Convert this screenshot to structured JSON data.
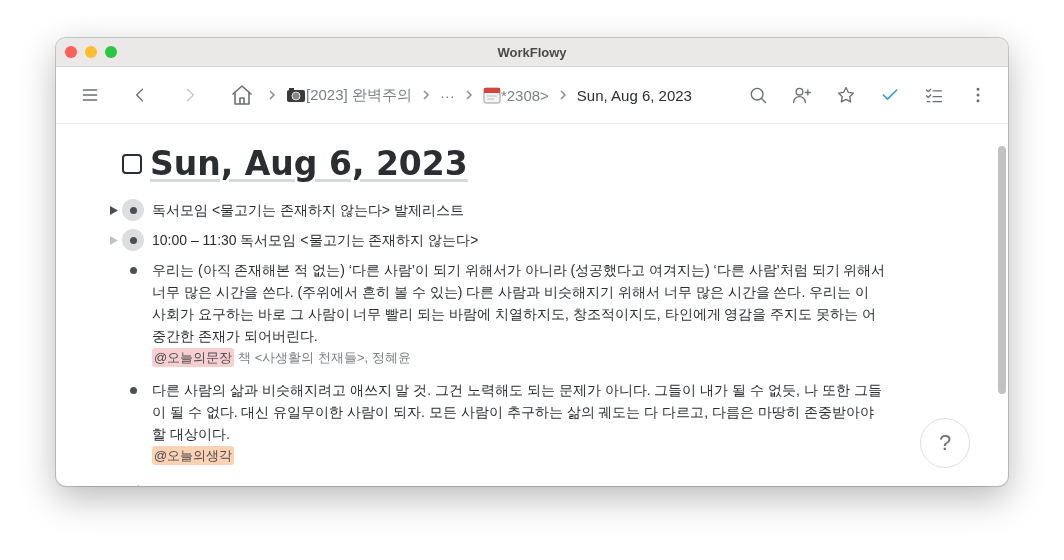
{
  "window": {
    "title": "WorkFlowy"
  },
  "breadcrumbs": [
    {
      "kind": "home"
    },
    {
      "kind": "camera",
      "label": "[2023] 완벽주의"
    },
    {
      "kind": "ellipsis",
      "label": "···"
    },
    {
      "kind": "calendar",
      "label": "*2308>"
    },
    {
      "kind": "current",
      "label": "Sun, Aug 6, 2023"
    }
  ],
  "toolbar": {
    "done_toggle_on": true
  },
  "page": {
    "title": "Sun, Aug 6, 2023",
    "checked": false
  },
  "items": [
    {
      "kind": "collapsed",
      "text": "독서모임 <물고기는 존재하지 않는다> 발제리스트",
      "dim_arrow": false
    },
    {
      "kind": "collapsed",
      "text": "10:00 – 11:30 독서모임 <물고기는 존재하지 않는다>",
      "dim_arrow": true
    },
    {
      "kind": "bullet",
      "text": "우리는 (아직 존재해본 적 없는) ‘다른 사람’이 되기 위해서가 아니라 (성공했다고 여겨지는) ‘다른 사람’처럼 되기 위해서 너무 많은 시간을 쓴다. (주위에서 흔히 볼 수 있는) 다른 사람과 비슷해지기 위해서 너무 많은 시간을 쓴다. 우리는 이 사회가 요구하는 바로 그 사람이 너무 빨리 되는 바람에 치열하지도, 창조적이지도, 타인에게 영감을 주지도 못하는 어중간한 존재가 되어버린다.",
      "note": {
        "tag": "@오늘의문장",
        "color": "#f8cfd1",
        "text": "책 <사생활의 천재들>, 정혜윤"
      }
    },
    {
      "kind": "bullet",
      "text": "다른 사람의 삶과 비슷해지려고 애쓰지 말 것. 그건 노력해도 되는 문제가 아니다. 그들이 내가 될 수 없듯, 나 또한 그들이 될 수 없다. 대신 유일무이한 사람이 되자. 모든 사람이 추구하는 삶의 궤도는 다 다르고, 다름은 마땅히 존중받아야할 대상이다.",
      "note": {
        "tag": "@오늘의생각",
        "color": "#fbd3b4"
      }
    }
  ],
  "help": {
    "label": "?"
  }
}
